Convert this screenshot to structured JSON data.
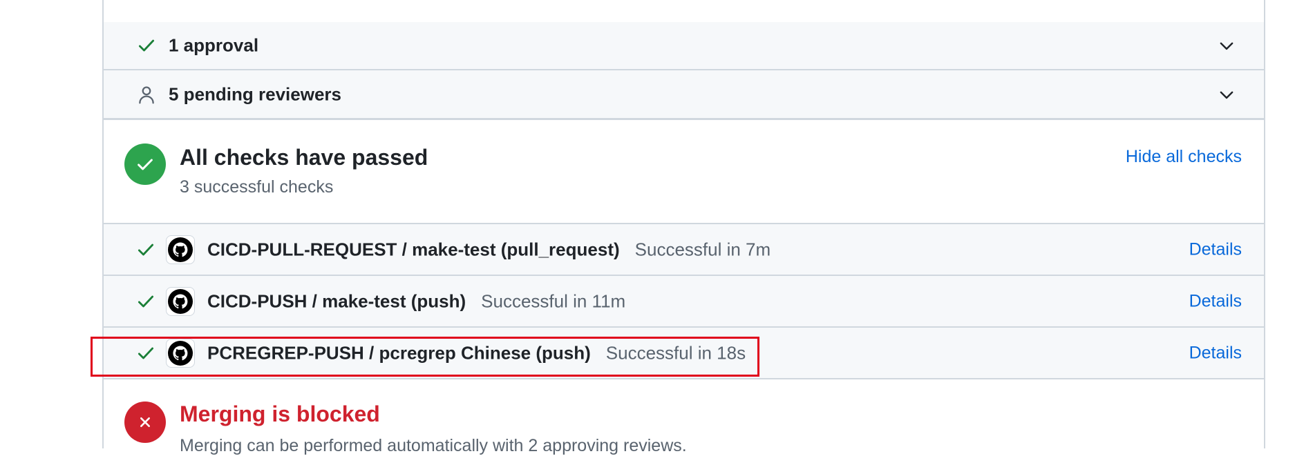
{
  "reviews": {
    "approval_label": "1 approval",
    "pending_label": "5 pending reviewers"
  },
  "checks": {
    "title": "All checks have passed",
    "subtitle": "3 successful checks",
    "hide_link": "Hide all checks",
    "items": [
      {
        "name": "CICD-PULL-REQUEST / make-test (pull_request)",
        "status": "Successful in 7m",
        "details_label": "Details"
      },
      {
        "name": "CICD-PUSH / make-test (push)",
        "status": "Successful in 11m",
        "details_label": "Details"
      },
      {
        "name": "PCREGREP-PUSH / pcregrep Chinese (push)",
        "status": "Successful in 18s",
        "details_label": "Details"
      }
    ]
  },
  "merge": {
    "title": "Merging is blocked",
    "subtitle": "Merging can be performed automatically with 2 approving reviews."
  },
  "colors": {
    "success": "#2da44e",
    "danger": "#cf222e",
    "link": "#0969da",
    "muted": "#59636e",
    "row_bg": "#f6f8fa",
    "border": "#d0d7de",
    "highlight": "#e0001b"
  },
  "icons": {
    "approval": "check-icon",
    "pending": "person-icon",
    "expand": "chevron-down-icon",
    "passed": "check-circle-icon",
    "blocked": "x-circle-icon",
    "check_app": "github-icon"
  }
}
